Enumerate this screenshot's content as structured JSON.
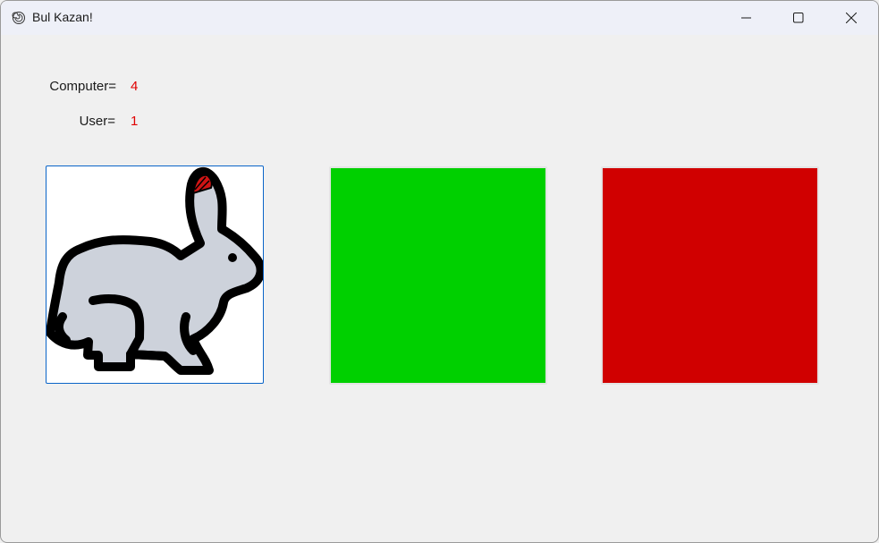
{
  "window": {
    "title": "Bul Kazan!",
    "app_icon": "spiral-icon",
    "controls": {
      "minimize_icon": "minimize-icon",
      "maximize_icon": "maximize-icon",
      "close_icon": "close-icon"
    }
  },
  "scores": {
    "computer_label": "Computer=",
    "computer_value": "4",
    "user_label": "User=",
    "user_value": "1",
    "value_color": "#e00000"
  },
  "cards": [
    {
      "content": "rabbit-image",
      "icon": "rabbit-icon",
      "fill": "#ffffff",
      "selected": true
    },
    {
      "content": "green-panel",
      "fill": "#00d000"
    },
    {
      "content": "red-panel",
      "fill": "#d00000"
    }
  ]
}
